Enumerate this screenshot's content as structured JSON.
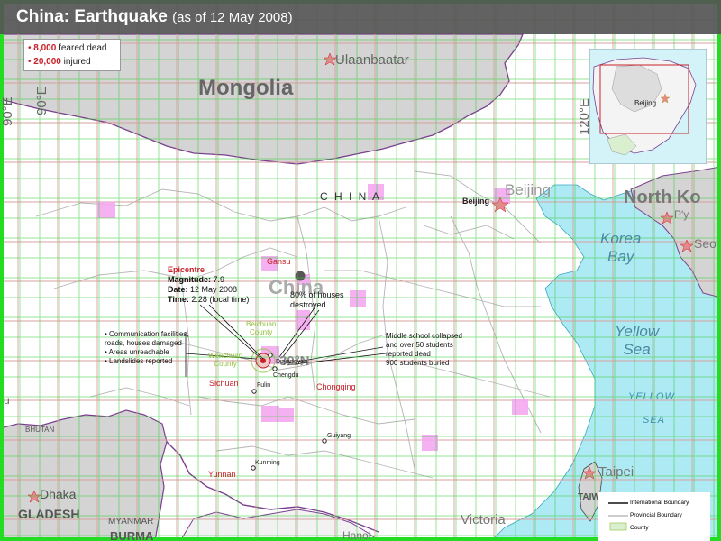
{
  "header": {
    "title_main": "China: Earthquake",
    "title_sub": "(as of 12 May 2008)"
  },
  "casualties": {
    "dead_value": "8,000",
    "dead_label": "feared dead",
    "injured_value": "20,000",
    "injured_label": "injured"
  },
  "countries": {
    "mongolia": "Mongolia",
    "china_upper": "C H I N A",
    "china_big": "China",
    "north_korea": "North Ko",
    "korea_bay": "Korea\nBay",
    "yellow_sea": "Yellow\nSea",
    "yellow_sea_caps": "YELLOW",
    "yellow_sea_caps2": "SEA",
    "myanmar": "MYANMAR",
    "burma": "BURMA",
    "bangladesh": "GLADESH",
    "bhutan": "BHUTAN",
    "taiwan": "TAIWAN"
  },
  "cities": {
    "ulaanbaatar": "Ulaanbaatar",
    "beijing_big": "Beijing",
    "beijing_small": "Beijing",
    "pyongyang": "P'y",
    "seoul": "Seo",
    "taipei": "Taipei",
    "dhaka": "Dhaka",
    "victoria": "Victoria",
    "dujiangyan": "Dujiangyan",
    "chengdu": "Chengdu",
    "fulin": "Fulin",
    "guiyang": "Guiyang",
    "kunming": "Kunming",
    "hanoi": "Hanoi"
  },
  "provinces": {
    "gansu": "Gansu",
    "sichuan": "Sichuan",
    "chongqing": "Chongqing",
    "yunnan": "Yunnan",
    "beichuan": "Beichuan\nCounty",
    "wenchuan": "Wenchuan\nCounty"
  },
  "graticule": {
    "lon90": "90°E",
    "lon90_left": "90°E",
    "lon120": "120°E",
    "lat30": "30°N",
    "lat30_left": "u"
  },
  "epicentre": {
    "heading": "Epicentre",
    "magnitude_label": "Magnitude:",
    "magnitude_value": "7.9",
    "date_label": "Date:",
    "date_value": "12 May 2008",
    "time_label": "Time:",
    "time_value": "2:28 (local time)"
  },
  "callouts": {
    "houses": "80% of houses\ndestroyed",
    "impacts": [
      "Communication facilities, roads, houses damaged",
      "Areas unreachable",
      "Landslides reported"
    ],
    "school": "Middle school collapsed\nand over 50 students\nreported dead\n900 students buried"
  },
  "inset": {
    "city": "Beijing"
  },
  "legend": {
    "international": "International Boundary",
    "provincial": "Provincial Boundary",
    "county": "County"
  },
  "colors": {
    "land": "#ffffff",
    "neighbour": "#d3d3d3",
    "sea": "#aeeaf3",
    "border_purple": "#7b3f8f",
    "grid_red": "#d9a0a0",
    "overlay_grid": "#3ecf3e",
    "highlight": "#f4a8f0",
    "alert_red": "#c8202a",
    "county_green": "#8fbf3a"
  }
}
